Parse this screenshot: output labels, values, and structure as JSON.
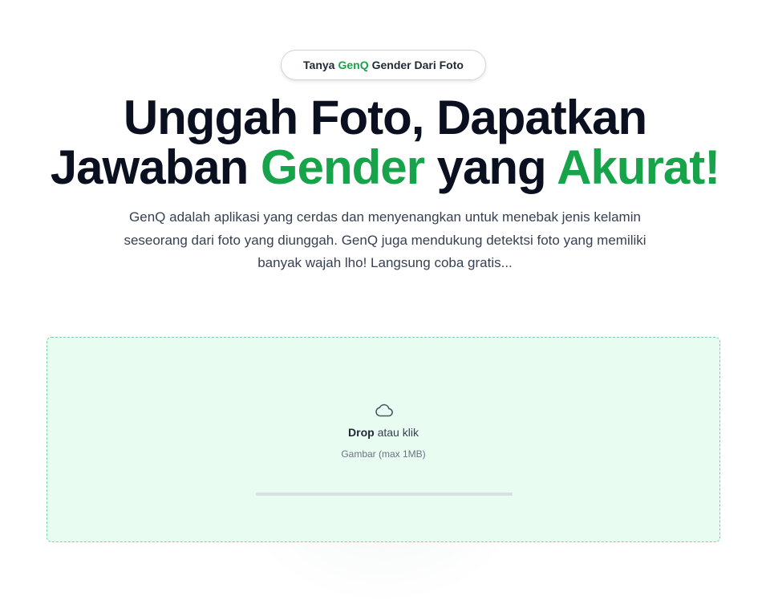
{
  "badge": {
    "prefix": "Tanya",
    "brand": "GenQ",
    "suffix": "Gender Dari Foto"
  },
  "hero": {
    "line1": "Unggah Foto, Dapatkan",
    "line2_part1": "Jawaban",
    "line2_highlight1": "Gender",
    "line2_part2": "yang",
    "line2_highlight2": "Akurat!",
    "description": "GenQ adalah aplikasi yang cerdas dan menyenangkan untuk menebak jenis kelamin seseorang dari foto yang diunggah. GenQ juga mendukung detektsi foto yang memiliki banyak wajah lho! Langsung coba gratis..."
  },
  "upload": {
    "icon": "cloud-icon",
    "drop_label": "Drop",
    "drop_suffix": "atau klik",
    "hint": "Gambar (max 1MB)",
    "progress": 0
  },
  "colors": {
    "accent": "#16a34a",
    "heading": "#0b1020",
    "dropzone_bg": "#e9fcf1",
    "dropzone_border": "#7dd3a8"
  }
}
